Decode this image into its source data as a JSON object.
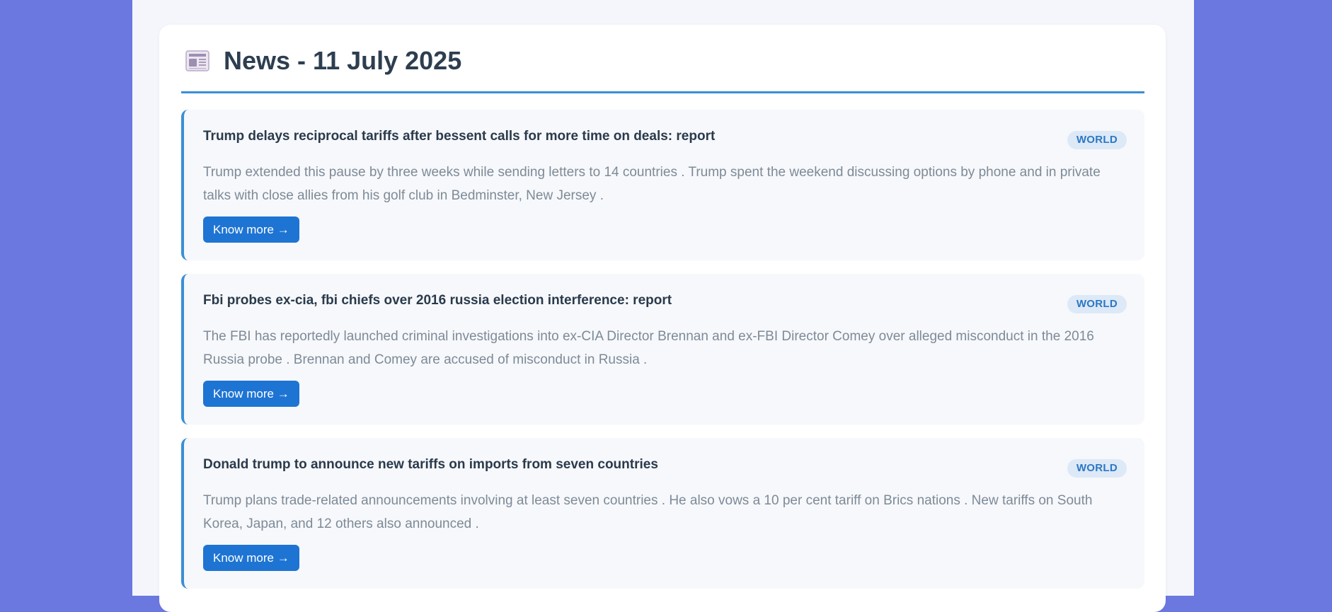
{
  "header": {
    "title": "News - 11 July 2025",
    "icon": "newspaper-icon"
  },
  "colors": {
    "background": "#6b78e0",
    "accent": "#3a8fd6",
    "button": "#1e74d3",
    "badge_bg": "#dde9f7",
    "badge_text": "#2b78c4"
  },
  "articles": [
    {
      "title": "Trump delays reciprocal tariffs after bessent calls for more time on deals: report",
      "category": "WORLD",
      "description": "Trump extended this pause by three weeks while sending letters to 14 countries . Trump spent the weekend discussing options by phone and in private talks with close allies from his golf club in Bedminster, New Jersey .",
      "button_label": "Know more →"
    },
    {
      "title": "Fbi probes ex-cia, fbi chiefs over 2016 russia election interference: report",
      "category": "WORLD",
      "description": "The FBI has reportedly launched criminal investigations into ex-CIA Director Brennan and ex-FBI Director Comey over alleged misconduct in the 2016 Russia probe . Brennan and Comey are accused of misconduct in Russia .",
      "button_label": "Know more →"
    },
    {
      "title": "Donald trump to announce new tariffs on imports from seven countries",
      "category": "WORLD",
      "description": "Trump plans trade-related announcements involving at least seven countries . He also vows a 10 per cent tariff on Brics nations . New tariffs on South Korea, Japan, and 12 others also announced .",
      "button_label": "Know more →"
    }
  ]
}
